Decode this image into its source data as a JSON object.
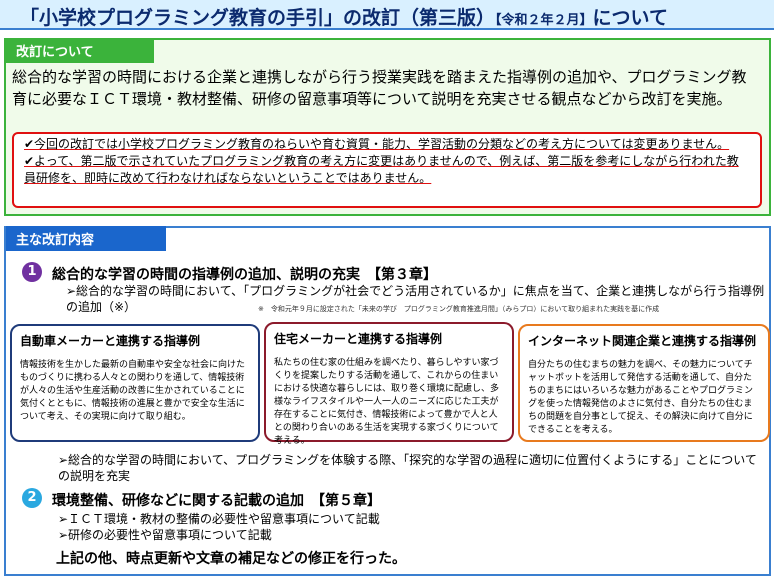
{
  "title": {
    "main": "「小学校プログラミング教育の手引」の改訂（第三版）",
    "date": "【令和２年２月】",
    "suffix": "について"
  },
  "revision": {
    "tab": "改訂について",
    "paragraph": "総合的な学習の時間における企業と連携しながら行う授業実践を踏まえた指導例の追加や、プログラミング教育に必要なＩＣＴ環境・教材整備、研修の留意事項等について説明を充実させる観点などから改訂を実施。",
    "notes": [
      "✔今回の改訂では小学校プログラミング教育のねらいや育む資質・能力、学習活動の分類などの考え方については変更ありません。",
      "✔よって、第二版で示されていたプログラミング教育の考え方に変更はありませんので、例えば、第二版を参考にしながら行われた教員研修を、即時に改めて行わなければならないということではありません。"
    ]
  },
  "main_changes": {
    "tab": "主な改訂内容",
    "item1": {
      "num": "1",
      "heading": "総合的な学習の時間の指導例の追加、説明の充実　【第３章】",
      "detail": "➢総合的な学習の時間において、「プログラミングが社会でどう活用されているか」に焦点を当て、企業と連携しながら行う指導例の追加（※）",
      "footnote": "※　令和元年９月に設定された「未来の学び　プログラミング教育推進月間」（みらプロ）において取り組まれた実践を基に作成",
      "cards": [
        {
          "title": "自動車メーカーと連携する指導例",
          "body": "情報技術を生かした最新の自動車や安全な社会に向けたものづくりに携わる人々との関わりを通して、情報技術が人々の生活や生産活動の改善に生かされていることに気付くとともに、情報技術の進展と豊かで安全な生活について考え、その実現に向けて取り組む。"
        },
        {
          "title": "住宅メーカーと連携する指導例",
          "body": "私たちの住む家の仕組みを調べたり、暮らしやすい家づくりを提案したりする活動を通して、これからの住まいにおける快適な暮らしには、取り巻く環境に配慮し、多様なライフスタイルや一人一人のニーズに応じた工夫が存在することに気付き、情報技術によって豊かで人と人との関わり合いのある生活を実現する家づくりについて考える。"
        },
        {
          "title": "インターネット関連企業と連携する指導例",
          "body": "自分たちの住むまちの魅力を調べ、その魅力についてチャットボットを活用して発信する活動を通して、自分たちのまちにはいろいろな魅力があることやプログラミングを使った情報発信のよさに気付き、自分たちの住むまちの問題を自分事として捉え、その解決に向けて自分にできることを考える。"
        }
      ],
      "after": "➢総合的な学習の時間において、プログラミングを体験する際、「探究的な学習の過程に適切に位置付くようにする」ことについての説明を充実"
    },
    "item2": {
      "num": "2",
      "heading": "環境整備、研修などに関する記載の追加　【第５章】",
      "bullets": [
        "➢ＩＣＴ環境・教材の整備の必要性や留意事項について記載",
        "➢研修の必要性や留意事項について記載"
      ]
    },
    "closing": "上記の他、時点更新や文章の補足などの修正を行った。"
  }
}
